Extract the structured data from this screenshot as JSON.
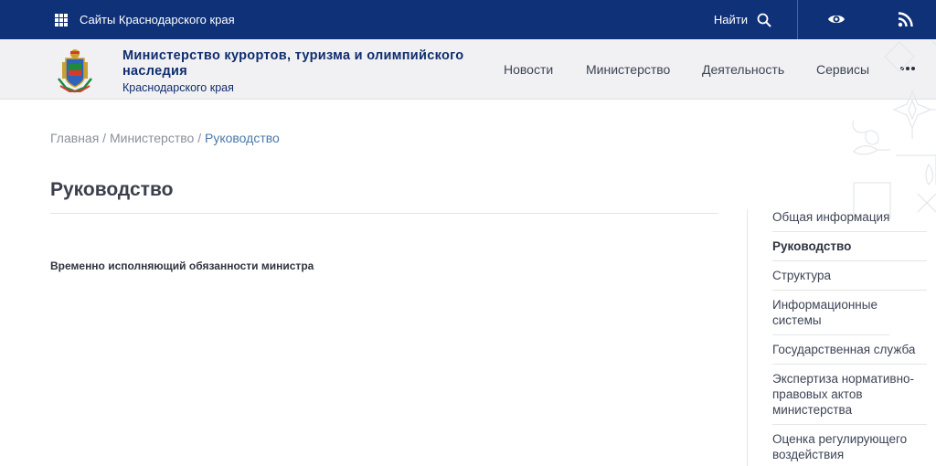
{
  "topbar": {
    "sites_label": "Сайты Краснодарского края",
    "search_label": "Найти"
  },
  "header": {
    "org_name": "Министерство курортов, туризма и олимпийского наследия",
    "org_region": "Краснодарского края",
    "nav": [
      "Новости",
      "Министерство",
      "Деятельность",
      "Сервисы"
    ]
  },
  "breadcrumb": {
    "home": "Главная",
    "sep1": " / ",
    "section": "Министерство",
    "sep2": " / ",
    "current": "Руководство"
  },
  "main": {
    "title": "Руководство",
    "position": "Временно исполняющий обязанности министра"
  },
  "sidebar": {
    "items": [
      "Общая информация",
      "Руководство",
      "Структура",
      "Информационные системы",
      "Государственная служба",
      "Экспертиза нормативно-правовых актов министерства",
      "Оценка регулирующего воздействия"
    ],
    "active_index": 1
  },
  "colors": {
    "topbar": "#0f3178",
    "header_bg": "#f1f1f3",
    "org_text": "#0f2d6e",
    "link_active": "#4a78a8"
  },
  "icons": [
    "apps-grid-icon",
    "search-icon",
    "eye-icon",
    "rss-icon",
    "more-dots-icon",
    "coat-of-arms-logo",
    "ornament-pattern"
  ]
}
